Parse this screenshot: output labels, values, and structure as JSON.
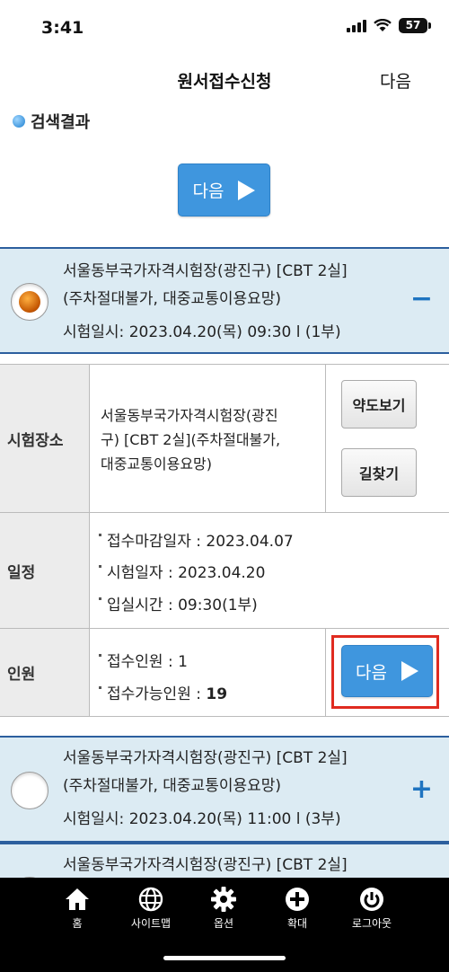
{
  "status": {
    "time": "3:41",
    "battery": "57"
  },
  "header": {
    "title": "원서접수신청",
    "next": "다음"
  },
  "section_title": "검색결과",
  "top_next_button": "다음",
  "results": [
    {
      "name_line1": "서울동부국가자격시험장(광진구) [CBT 2실]",
      "name_line2": "(주차절대불가, 대중교통이용요망)",
      "datetime": "시험일시: 2023.04.20(목) 09:30 l  (1부)",
      "toggle": "−",
      "selected": true
    },
    {
      "name_line1": "서울동부국가자격시험장(광진구) [CBT 2실]",
      "name_line2": "(주차절대불가, 대중교통이용요망)",
      "datetime": "시험일시: 2023.04.20(목) 11:00 l  (3부)",
      "toggle": "+",
      "selected": false
    },
    {
      "name_line1": "서울동부국가자격시험장(광진구) [CBT 2실]"
    }
  ],
  "detail": {
    "location_label": "시험장소",
    "location_line1": "서울동부국가자격시험장(광진",
    "location_line2": "구) [CBT 2실](주차절대불가,",
    "location_line3": "대중교통이용요망)",
    "map_button": "약도보기",
    "route_button": "길찾기",
    "schedule_label": "일정",
    "schedule_items": [
      "접수마감일자 : 2023.04.07",
      "시험일자 : 2023.04.20",
      "입실시간 : 09:30(1부)"
    ],
    "people_label": "인원",
    "applied_label": "접수인원 : 1",
    "available_label": "접수가능인원 : ",
    "available_value": "19",
    "next_button": "다음"
  },
  "bottom_nav": [
    {
      "label": "홈",
      "icon": "home-icon"
    },
    {
      "label": "사이트맵",
      "icon": "globe-icon"
    },
    {
      "label": "옵션",
      "icon": "gear-icon"
    },
    {
      "label": "확대",
      "icon": "plus-circle-icon"
    },
    {
      "label": "로그아웃",
      "icon": "power-icon"
    }
  ],
  "colors": {
    "accent": "#3f96de",
    "row_bg": "#dcebf3",
    "row_border": "#2c5f9e",
    "highlight": "#e02b20"
  }
}
